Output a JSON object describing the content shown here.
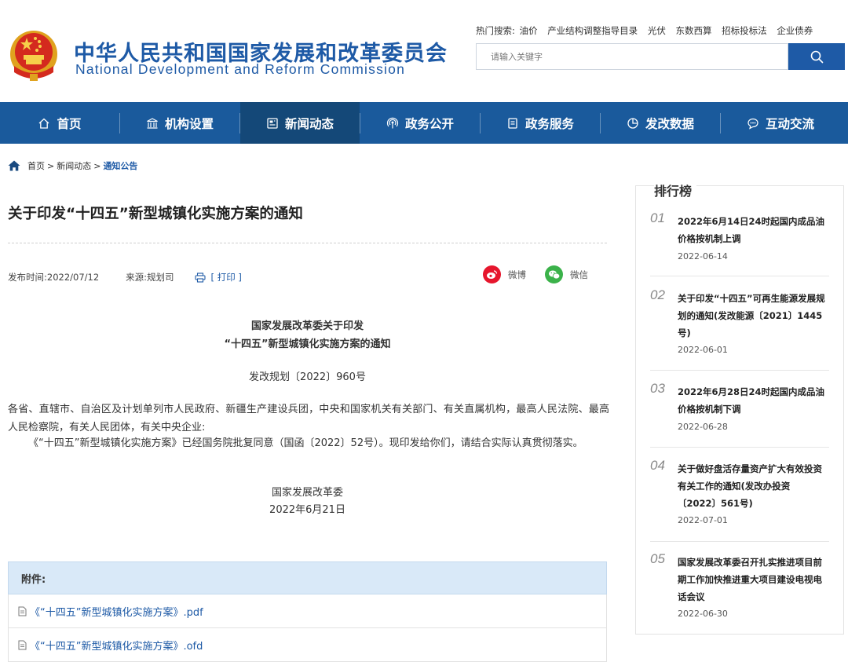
{
  "header": {
    "site_name_cn": "中华人民共和国国家发展和改革委员会",
    "site_name_en": "National Development and Reform Commission",
    "hot_label": "热门搜索:",
    "hot_terms": [
      "油价",
      "产业结构调整指导目录",
      "光伏",
      "东数西算",
      "招标投标法",
      "企业债券"
    ],
    "search_placeholder": "请输入关键字"
  },
  "nav": {
    "items": [
      {
        "label": "首页",
        "icon": "home-icon"
      },
      {
        "label": "机构设置",
        "icon": "building-icon"
      },
      {
        "label": "新闻动态",
        "icon": "newspaper-icon"
      },
      {
        "label": "政务公开",
        "icon": "broadcast-icon"
      },
      {
        "label": "政务服务",
        "icon": "document-icon"
      },
      {
        "label": "发改数据",
        "icon": "pie-chart-icon"
      },
      {
        "label": "互动交流",
        "icon": "chat-icon"
      }
    ],
    "active_index": 2
  },
  "breadcrumb": {
    "items": [
      "首页",
      "新闻动态",
      "通知公告"
    ],
    "separator": ">"
  },
  "article": {
    "title": "关于印发“十四五”新型城镇化实施方案的通知",
    "publish_label": "发布时间:",
    "publish_date": "2022/07/12",
    "source_label": "来源:",
    "source": "规划司",
    "print_label": "[ 打印 ]",
    "share_weibo": "微博",
    "share_wechat": "微信",
    "notice_title_line1": "国家发展改革委关于印发",
    "notice_title_line2": "“十四五”新型城镇化实施方案的通知",
    "doc_number": "发改规划〔2022〕960号",
    "paragraph1": "各省、直辖市、自治区及计划单列市人民政府、新疆生产建设兵团，中央和国家机关有关部门、有关直属机构，最高人民法院、最高人民检察院，有关人民团体，有关中央企业:",
    "paragraph2": "《“十四五”新型城镇化实施方案》已经国务院批复同意（国函〔2022〕52号）。现印发给你们，请结合实际认真贯彻落实。",
    "signature": "国家发展改革委",
    "sign_date": "2022年6月21日"
  },
  "attachments": {
    "header": "附件:",
    "files": [
      "《“十四五”新型城镇化实施方案》.pdf",
      "《“十四五”新型城镇化实施方案》.ofd"
    ]
  },
  "ranking": {
    "title": "排行榜",
    "items": [
      {
        "num": "01",
        "title": "2022年6月14日24时起国内成品油价格按机制上调",
        "date": "2022-06-14"
      },
      {
        "num": "02",
        "title": "关于印发“十四五”可再生能源发展规划的通知(发改能源〔2021〕1445号)",
        "date": "2022-06-01"
      },
      {
        "num": "03",
        "title": "2022年6月28日24时起国内成品油价格按机制下调",
        "date": "2022-06-28"
      },
      {
        "num": "04",
        "title": "关于做好盘活存量资产扩大有效投资有关工作的通知(发改办投资〔2022〕561号)",
        "date": "2022-07-01"
      },
      {
        "num": "05",
        "title": "国家发展改革委召开扎实推进项目前期工作加快推进重大项目建设电视电话会议",
        "date": "2022-06-30"
      }
    ]
  },
  "colors": {
    "brand_blue": "#1e5aa6",
    "nav_bg": "#1a5a9c",
    "nav_active": "#144878",
    "weibo_red": "#e6162d",
    "wechat_green": "#3bb24a"
  }
}
